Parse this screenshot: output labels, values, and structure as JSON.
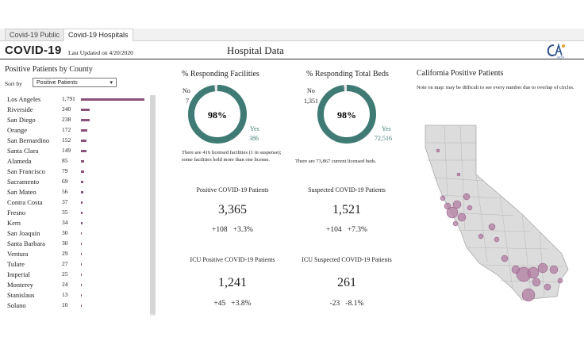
{
  "tabs": [
    {
      "label": "Covid-19 Public",
      "active": false
    },
    {
      "label": "Covid-19 Hospitals",
      "active": true
    }
  ],
  "header": {
    "title": "COVID-19",
    "updated": "Last Updated on 4/20/2020",
    "page_title": "Hospital Data",
    "logo_text": "CA.GOV"
  },
  "left": {
    "section_title": "Positive Patients by County",
    "sort_label": "Sort by",
    "sort_value": "Positive Patients",
    "counties": [
      {
        "name": "Los Angeles",
        "value": "1,791",
        "n": 1791
      },
      {
        "name": "Riverside",
        "value": "240",
        "n": 240
      },
      {
        "name": "San Diego",
        "value": "238",
        "n": 238
      },
      {
        "name": "Orange",
        "value": "172",
        "n": 172
      },
      {
        "name": "San Bernardino",
        "value": "152",
        "n": 152
      },
      {
        "name": "Santa Clara",
        "value": "149",
        "n": 149
      },
      {
        "name": "Alameda",
        "value": "85",
        "n": 85
      },
      {
        "name": "San Francisco",
        "value": "79",
        "n": 79
      },
      {
        "name": "Sacramento",
        "value": "69",
        "n": 69
      },
      {
        "name": "San Mateo",
        "value": "56",
        "n": 56
      },
      {
        "name": "Contra Costa",
        "value": "37",
        "n": 37
      },
      {
        "name": "Fresno",
        "value": "35",
        "n": 35
      },
      {
        "name": "Kern",
        "value": "34",
        "n": 34
      },
      {
        "name": "San Joaquin",
        "value": "30",
        "n": 30
      },
      {
        "name": "Santa Barbara",
        "value": "30",
        "n": 30
      },
      {
        "name": "Ventura",
        "value": "29",
        "n": 29
      },
      {
        "name": "Tulare",
        "value": "27",
        "n": 27
      },
      {
        "name": "Imperial",
        "value": "25",
        "n": 25
      },
      {
        "name": "Monterey",
        "value": "24",
        "n": 24
      },
      {
        "name": "Stanislaus",
        "value": "13",
        "n": 13
      },
      {
        "name": "Solano",
        "value": "10",
        "n": 10
      }
    ]
  },
  "facilities": {
    "title": "% Responding Facilities",
    "pct": "98%",
    "yes_label": "Yes",
    "yes_value": "386",
    "no_label": "No",
    "no_value": "7",
    "fraction_yes": 0.982,
    "note": "There are 416 licensed facilities (1 in suspense); some facilities hold more than one license."
  },
  "beds": {
    "title": "% Responding Total Beds",
    "pct": "98%",
    "yes_label": "Yes",
    "yes_value": "72,516",
    "no_label": "No",
    "no_value": "1,351",
    "fraction_yes": 0.982,
    "note": "There are 73,867 current licensed beds."
  },
  "kpis": {
    "positive": {
      "title": "Positive COVID-19 Patients",
      "value": "3,365",
      "delta": "+108",
      "pct": "+3.3%"
    },
    "suspected": {
      "title": "Suspected COVID-19 Patients",
      "value": "1,521",
      "delta": "+104",
      "pct": "+7.3%"
    },
    "icu_positive": {
      "title": "ICU Positive COVID-19 Patients",
      "value": "1,241",
      "delta": "+45",
      "pct": "+3.8%"
    },
    "icu_suspected": {
      "title": "ICU Suspected COVID-19 Patients",
      "value": "261",
      "delta": "-23",
      "pct": "-8.1%"
    }
  },
  "map": {
    "title": "California Positive Patients",
    "note": "Note on map: may be difficult to see every number due to overlap of circles."
  },
  "colors": {
    "donut": "#3f7b74",
    "donut_light": "#e6e6e6",
    "bar": "#8b4f7c",
    "bubble": "#b07ca2"
  }
}
